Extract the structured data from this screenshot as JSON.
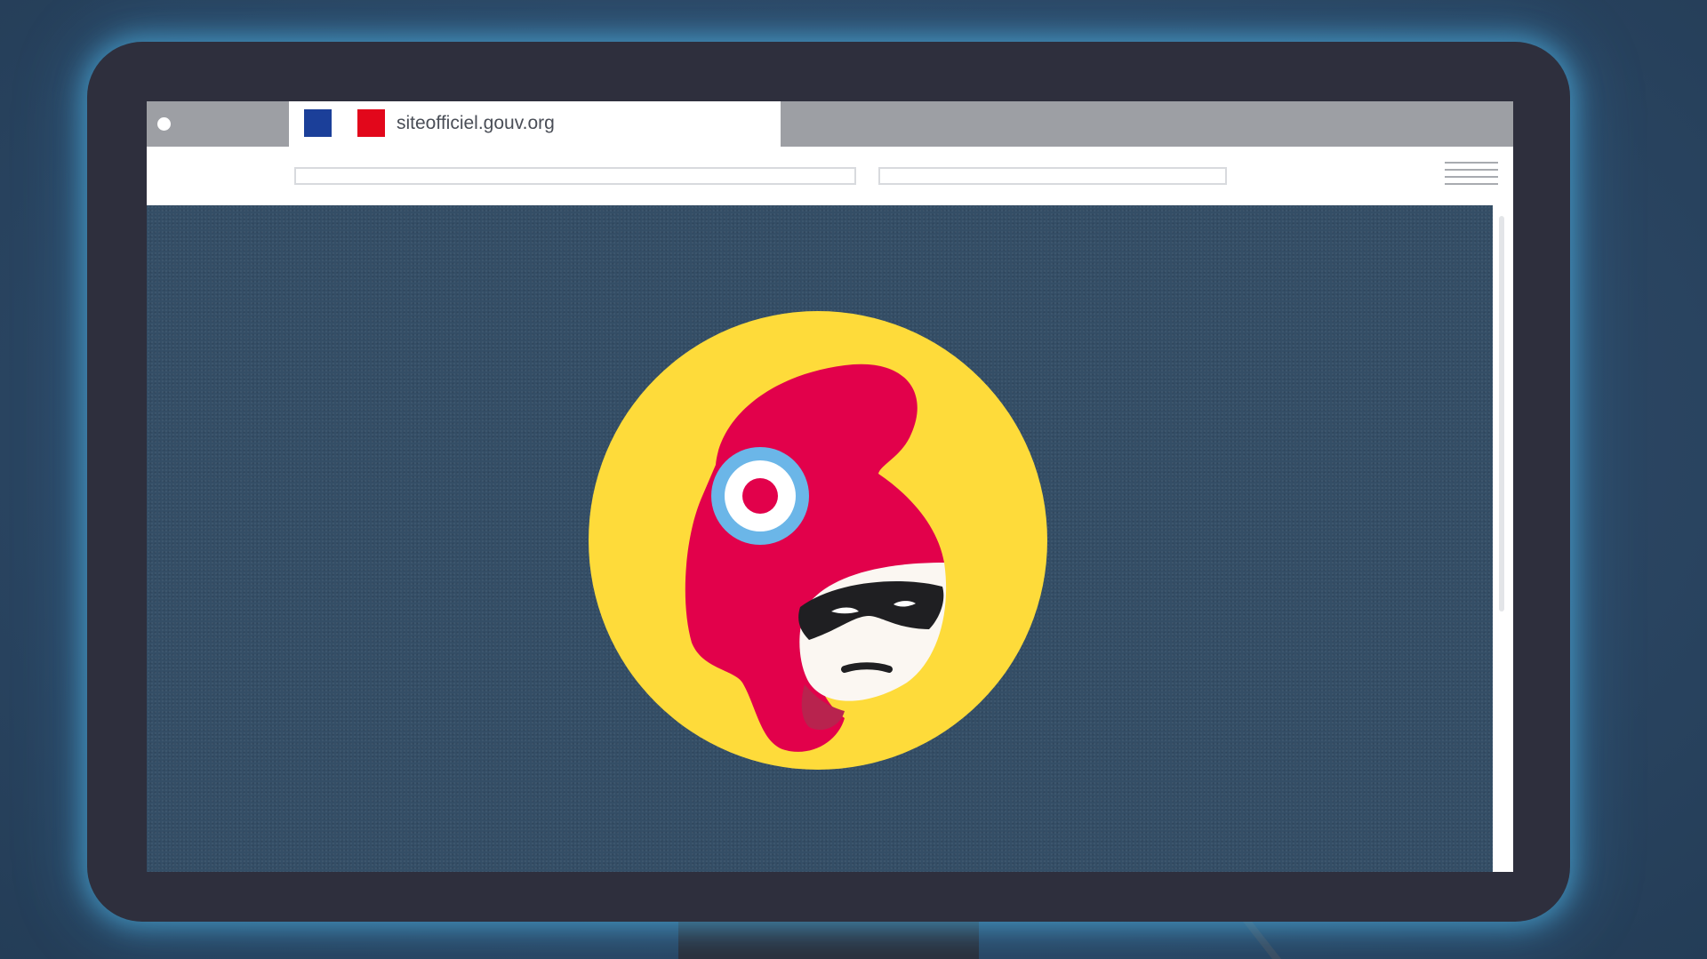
{
  "browser": {
    "tab_title": "siteofficiel.gouv.org"
  },
  "colors": {
    "flag_blue": "#1b3f99",
    "flag_red": "#e2071b",
    "content_background": "#344e66",
    "logo_circle": "#fedb3a",
    "logo_red": "#e2014b"
  },
  "icons": {
    "tab_flag_left": "blue-square-icon",
    "tab_flag_right": "red-square-icon",
    "menu": "hamburger-menu-icon",
    "logo": "masked-marianne-icon"
  }
}
